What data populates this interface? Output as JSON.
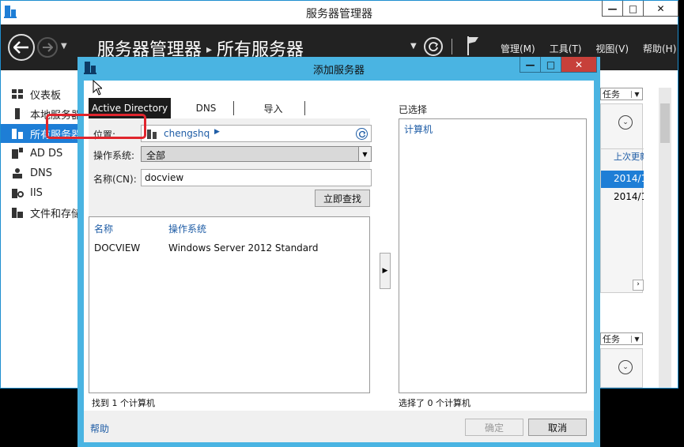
{
  "main_window": {
    "title": "服务器管理器",
    "heading_root": "服务器管理器",
    "heading_sub": "所有服务器",
    "menu": [
      "管理(M)",
      "工具(T)",
      "视图(V)",
      "帮助(H)"
    ],
    "sidebar": [
      {
        "label": "仪表板",
        "icon": "dashboard-icon"
      },
      {
        "label": "本地服务器",
        "icon": "server-icon"
      },
      {
        "label": "所有服务器",
        "icon": "servers-icon",
        "active": true
      },
      {
        "label": "AD DS",
        "icon": "adds-icon"
      },
      {
        "label": "DNS",
        "icon": "dns-icon"
      },
      {
        "label": "IIS",
        "icon": "iis-icon"
      },
      {
        "label": "文件和存储服务",
        "icon": "storage-icon"
      }
    ],
    "right_panel": {
      "tasks_label": "任务",
      "last_update_label": "上次更新",
      "dates": [
        "2014/1",
        "2014/1"
      ]
    }
  },
  "dialog": {
    "title": "添加服务器",
    "tabs": [
      "Active Directory",
      "DNS",
      "导入"
    ],
    "location_label": "位置:",
    "location_value": "chengshq",
    "os_label": "操作系统:",
    "os_value": "全部",
    "name_label": "名称(CN):",
    "name_value": "docview",
    "search_button": "立即查找",
    "columns": [
      "名称",
      "操作系统"
    ],
    "results": [
      {
        "name": "DOCVIEW",
        "os": "Windows Server 2012 Standard"
      }
    ],
    "found_text": "找到 1 个计算机",
    "selected_label": "已选择",
    "selected_column": "计算机",
    "selected_count": "选择了 0 个计算机",
    "help": "帮助",
    "ok": "确定",
    "cancel": "取消"
  },
  "colors": {
    "accent": "#1e7ed6",
    "dialog_frame": "#4ab4e2",
    "close_button": "#c7403a",
    "highlight": "#e0252d",
    "link": "#1f5da6"
  }
}
